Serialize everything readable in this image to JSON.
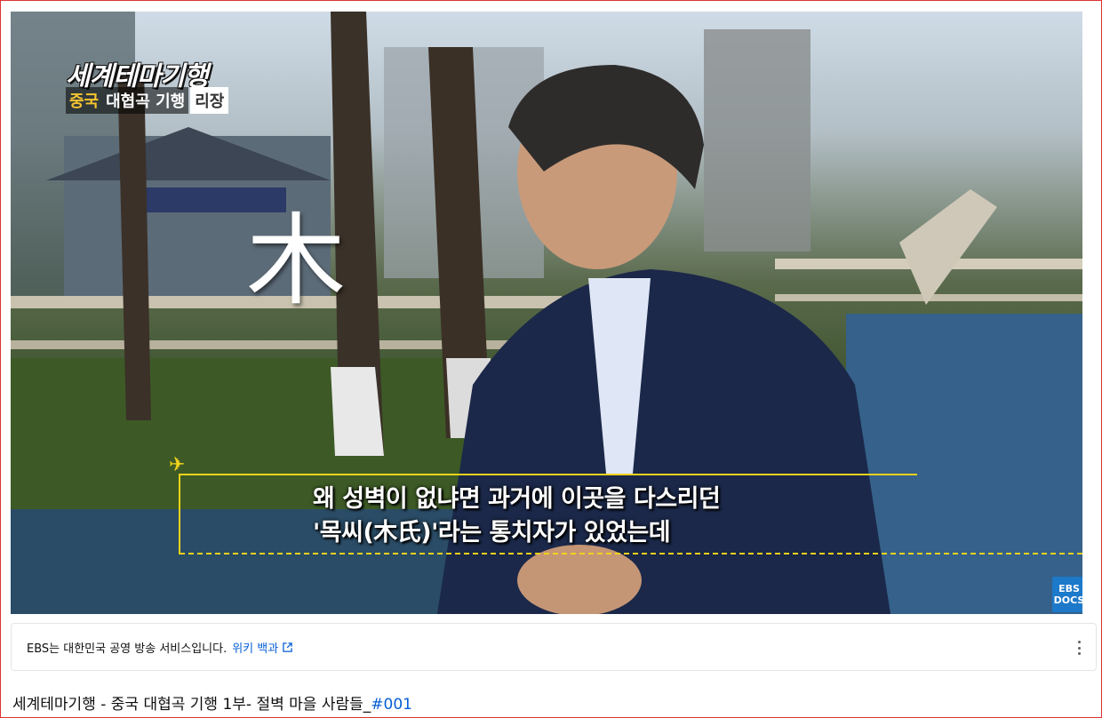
{
  "video": {
    "logo_text": "세계테마기행",
    "episode_tag": {
      "country": "중국",
      "series": "대협곡 기행",
      "place": "리장"
    },
    "overlay_char": "木",
    "subtitle_lines": [
      "왜 성벽이 없냐면 과거에 이곳을 다스리던",
      "'목씨(木氏)'라는 통치자가 있었는데"
    ],
    "channel_badge": {
      "line1": "EBS",
      "line2": "DOCS"
    },
    "accent_color": "#f1d21b"
  },
  "info_panel": {
    "text": "EBS는 대한민국 공영 방송 서비스입니다.",
    "link_label": "위키 백과",
    "icons": [
      "external-link-icon",
      "more-vert-icon"
    ]
  },
  "title": {
    "text": "세계테마기행 - 중국 대협곡 기행 1부- 절벽 마을 사람들_",
    "hashtag": "#001"
  }
}
